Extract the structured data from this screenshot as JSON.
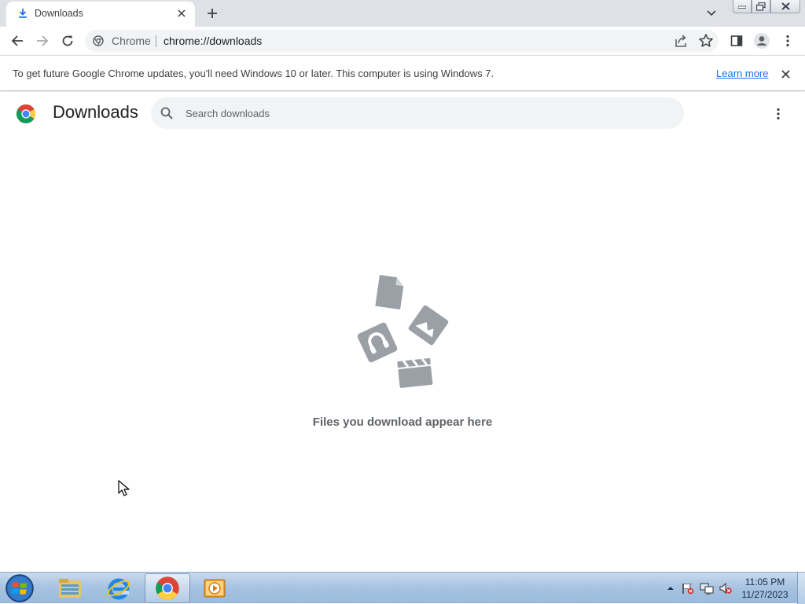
{
  "browser": {
    "tab": {
      "title": "Downloads"
    },
    "omnibox": {
      "site_label": "Chrome",
      "url": "chrome://downloads"
    }
  },
  "infobar": {
    "message": "To get future Google Chrome updates, you'll need Windows 10 or later. This computer is using Windows 7.",
    "link_label": "Learn more"
  },
  "page": {
    "title": "Downloads",
    "search": {
      "placeholder": "Search downloads",
      "value": ""
    },
    "empty_message": "Files you download appear here"
  },
  "taskbar": {
    "apps": [
      "windows-explorer",
      "internet-explorer",
      "google-chrome",
      "media-player"
    ],
    "active_app": "google-chrome",
    "clock": {
      "time": "11:05 PM",
      "date": "11/27/2023"
    }
  },
  "colors": {
    "accent_blue": "#1a73e8",
    "tab_strip": "#dee1e6",
    "omnibox_bg": "#f1f3f4",
    "icon_gray": "#9aa0a6"
  }
}
